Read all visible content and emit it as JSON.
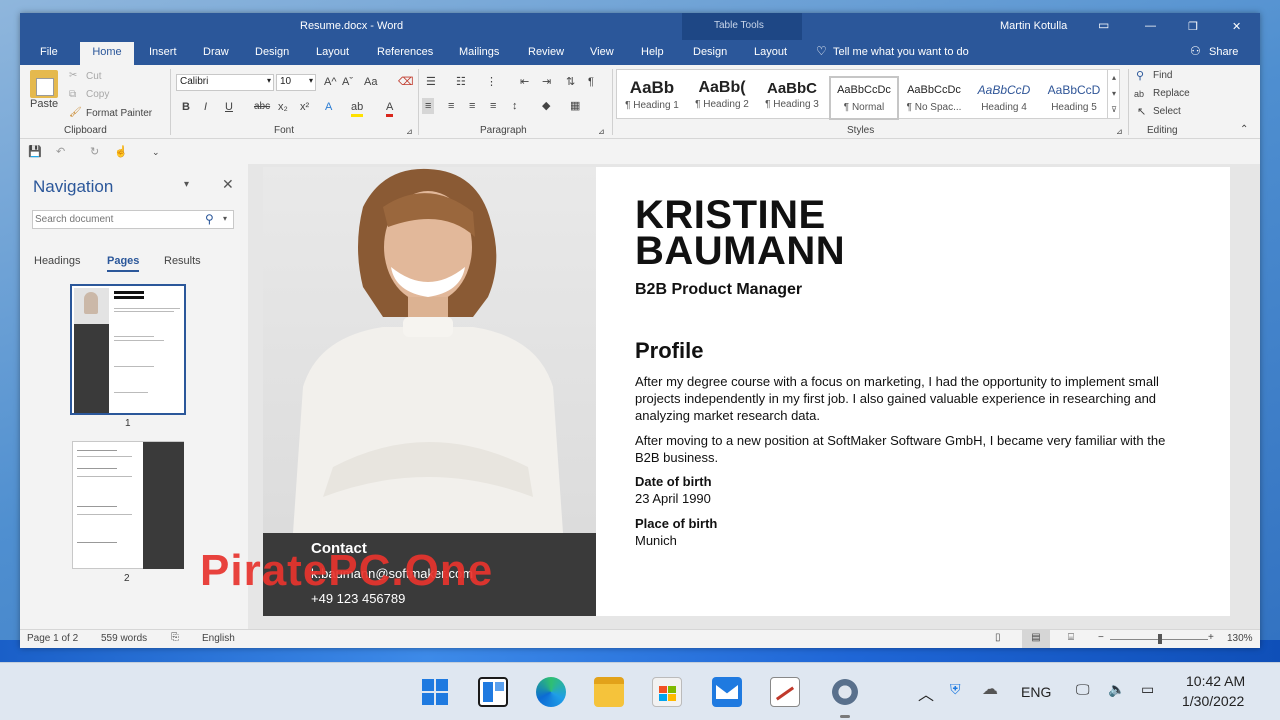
{
  "window": {
    "title": "Resume.docx  -  Word",
    "contextual_group": "Table Tools",
    "user": "Martin Kotulla",
    "controls": {
      "minimize": "—",
      "restore": "❐",
      "close": "✕"
    }
  },
  "tabs": [
    "File",
    "Home",
    "Insert",
    "Draw",
    "Design",
    "Layout",
    "References",
    "Mailings",
    "Review",
    "View",
    "Help",
    "Design",
    "Layout"
  ],
  "tell_me": "Tell me what you want to do",
  "share": "Share",
  "ribbon": {
    "clipboard": {
      "paste": "Paste",
      "cut": "Cut",
      "copy": "Copy",
      "format_painter": "Format Painter",
      "label": "Clipboard"
    },
    "font": {
      "family": "Calibri",
      "size": "10",
      "label": "Font",
      "bold": "B",
      "italic": "I",
      "underline": "U",
      "strike": "abc",
      "sub": "x₂",
      "sup": "x²",
      "grow": "A^",
      "shrink": "Aˇ",
      "case": "Aa",
      "text_effects": "A",
      "highlight": "ab",
      "font_color": "A"
    },
    "paragraph": {
      "label": "Paragraph",
      "pilcrow": "¶"
    },
    "styles": {
      "label": "Styles",
      "items": [
        {
          "sample": "AaBb",
          "name": "¶ Heading 1"
        },
        {
          "sample": "AaBb(",
          "name": "¶ Heading 2"
        },
        {
          "sample": "AaBbC",
          "name": "¶ Heading 3"
        },
        {
          "sample": "AaBbCcDc",
          "name": "¶ Normal"
        },
        {
          "sample": "AaBbCcDc",
          "name": "¶ No Spac..."
        },
        {
          "sample": "AaBbCcD",
          "name": "Heading 4"
        },
        {
          "sample": "AaBbCcD",
          "name": "Heading 5"
        }
      ]
    },
    "editing": {
      "label": "Editing",
      "find": "Find",
      "replace": "Replace",
      "select": "Select"
    }
  },
  "navigation": {
    "title": "Navigation",
    "search_placeholder": "Search document",
    "tabs": [
      "Headings",
      "Pages",
      "Results"
    ],
    "active_tab": "Pages",
    "pages": [
      "1",
      "2"
    ]
  },
  "document": {
    "name_line1": "KRISTINE",
    "name_line2": "BAUMANN",
    "job_title": "B2B Product Manager",
    "profile_heading": "Profile",
    "paragraph1": "After my degree course with a focus on marketing, I had the opportunity to implement small projects independently in my first job. I also gained valuable experience in researching and analyzing market research data.",
    "paragraph2": "After moving to a new position at SoftMaker Software GmbH, I became very familiar with the B2B business.",
    "dob_label": "Date of birth",
    "dob_value": "23 April 1990",
    "pob_label": "Place of birth",
    "pob_value": "Munich",
    "contact_heading": "Contact",
    "contact_email": "k.baumann@softmaker.com",
    "contact_phone": "+49 123 456789"
  },
  "watermark": "PiratePC.One",
  "status": {
    "page": "Page 1 of 2",
    "words": "559 words",
    "language": "English",
    "zoom": "130%"
  },
  "taskbar": {
    "language": "ENG",
    "time": "10:42 AM",
    "date": "1/30/2022"
  },
  "colors": {
    "word_blue": "#2b579a",
    "watermark_red": "#e8342e"
  }
}
